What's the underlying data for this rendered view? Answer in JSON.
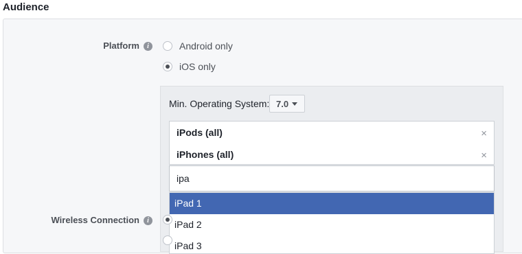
{
  "section": {
    "title": "Audience"
  },
  "platform": {
    "label": "Platform",
    "info_icon": "i",
    "options": [
      {
        "label": "Android only",
        "checked": false
      },
      {
        "label": "iOS only",
        "checked": true
      }
    ]
  },
  "ios": {
    "min_os_label": "Min. Operating System:",
    "min_os_value": "7.0",
    "devices": [
      {
        "label": "iPods (all)",
        "remove": "×"
      },
      {
        "label": "iPhones (all)",
        "remove": "×"
      }
    ],
    "search_value": "ipa",
    "suggestions": [
      "iPad 1",
      "iPad 2",
      "iPad 3"
    ],
    "highlighted_index": 0
  },
  "wireless": {
    "label": "Wireless Connection",
    "info_icon": "i"
  },
  "colors": {
    "accent": "#4267b2",
    "panel_bg": "#f6f7f9",
    "ios_box_bg": "#ebedf0"
  }
}
